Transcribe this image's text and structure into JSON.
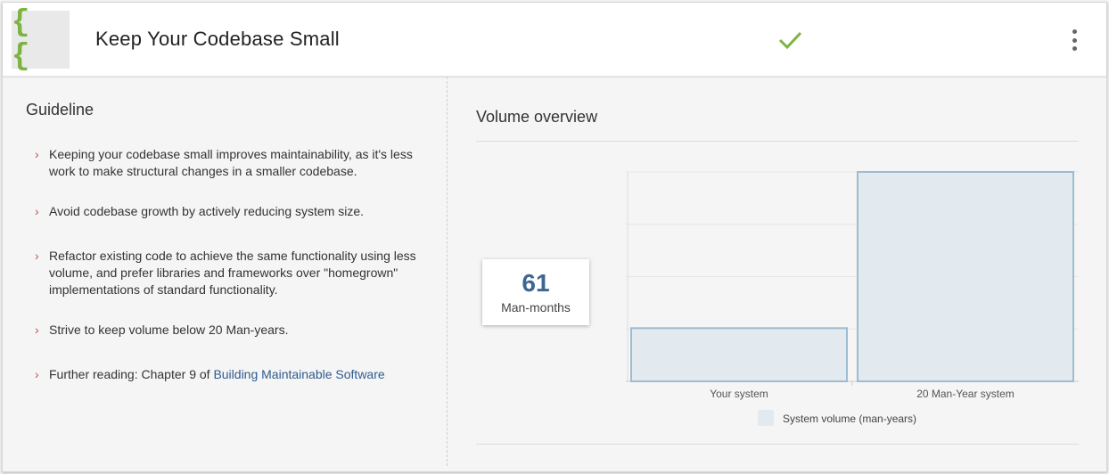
{
  "header": {
    "logo_text": "{ {",
    "title": "Keep Your Codebase Small",
    "status_icon": "checkmark-icon",
    "menu_icon": "more-vertical-icon"
  },
  "guideline": {
    "title": "Guideline",
    "items": [
      {
        "text": "Keeping your codebase small improves maintainability, as it's less work to make structural changes in a smaller codebase."
      },
      {
        "text": "Avoid codebase growth by actively reducing system size."
      },
      {
        "text": "Refactor existing code to achieve the same functionality using less volume, and prefer libraries and frameworks over \"homegrown\" implementations of standard functionality."
      },
      {
        "text": "Strive to keep volume below 20 Man-years."
      },
      {
        "text": "Further reading: Chapter 9 of ",
        "link": "Building Maintainable Software"
      }
    ]
  },
  "volume": {
    "title": "Volume overview",
    "metric_value": "61",
    "metric_unit": "Man-months"
  },
  "colors": {
    "accent_green": "#7cb342",
    "link_blue": "#2e5b8e",
    "metric_blue": "#3e6691",
    "bar_fill": "#e3eaef",
    "bar_stroke": "#9dbcd0"
  },
  "chart_data": {
    "type": "bar",
    "categories": [
      "Your system",
      "20 Man-Year system"
    ],
    "series": [
      {
        "name": "System volume (man-years)",
        "values": [
          5.08,
          20
        ]
      }
    ],
    "ylim": [
      0,
      20
    ],
    "grid": true,
    "legend": "bottom"
  }
}
